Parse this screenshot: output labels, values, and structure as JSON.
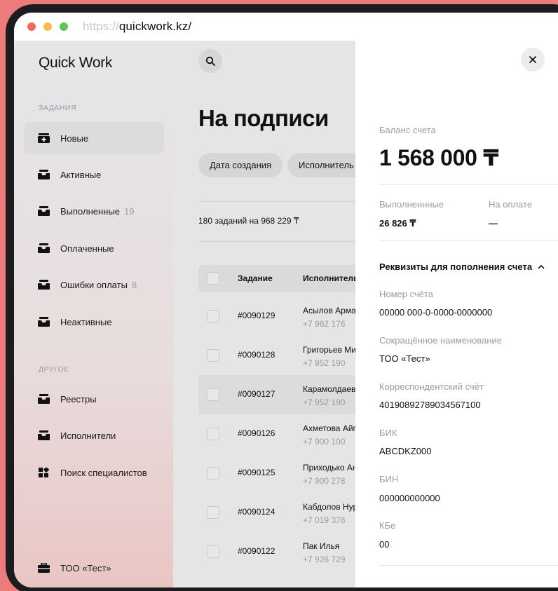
{
  "browser": {
    "url_protocol": "https://",
    "url_host": "quickwork.kz/"
  },
  "sidebar": {
    "logo": "Quick Work",
    "section_tasks": "ЗАДАНИЯ",
    "section_other": "ДРУГОЕ",
    "items": [
      {
        "label": "Новые",
        "count": "",
        "icon": "inbox-plus-icon"
      },
      {
        "label": "Активные",
        "count": "",
        "icon": "inbox-icon"
      },
      {
        "label": "Выполненные",
        "count": "19",
        "icon": "inbox-icon"
      },
      {
        "label": "Оплаченные",
        "count": "",
        "icon": "inbox-icon"
      },
      {
        "label": "Ошибки оплаты",
        "count": "8",
        "icon": "inbox-icon"
      },
      {
        "label": "Неактивные",
        "count": "",
        "icon": "inbox-icon"
      }
    ],
    "other_items": [
      {
        "label": "Реестры",
        "icon": "inbox-icon"
      },
      {
        "label": "Исполнители",
        "icon": "inbox-icon"
      },
      {
        "label": "Поиск специалистов",
        "icon": "grid-icon"
      }
    ],
    "company": "ТОО «Тест»"
  },
  "main": {
    "title": "На подписи",
    "filters": [
      "Дата создания",
      "Исполнитель"
    ],
    "summary": "180 заданий на 968 229 ₸",
    "columns": [
      "Задание",
      "Исполнитель"
    ],
    "rows": [
      {
        "task": "#0090129",
        "name": "Асылов Арман",
        "phone": "+7 962 176"
      },
      {
        "task": "#0090128",
        "name": "Григорьев Михаил",
        "phone": "+7 952 190"
      },
      {
        "task": "#0090127",
        "name": "Карамолдаев",
        "phone": "+7 952 190"
      },
      {
        "task": "#0090126",
        "name": "Ахметова Айгуль",
        "phone": "+7 900 100"
      },
      {
        "task": "#0090125",
        "name": "Приходько Анна",
        "phone": "+7 900 278"
      },
      {
        "task": "#0090124",
        "name": "Кабдолов Нурлан",
        "phone": "+7 019 378"
      },
      {
        "task": "#0090122",
        "name": "Пак Илья",
        "phone": "+7 926 729"
      }
    ]
  },
  "panel": {
    "balance_label": "Баланс счета",
    "balance_value": "1 568 000 ₸",
    "done_label": "Выполненнные",
    "done_value": "26 826 ₸",
    "payment_label": "На оплате",
    "payment_value": "—",
    "requisites_title": "Реквизиты для пополнения счета",
    "fields": [
      {
        "label": "Номер счёта",
        "value": "00000 000-0-0000-0000000"
      },
      {
        "label": "Сокращённое наименование",
        "value": "ТОО «Тест»"
      },
      {
        "label": "Корреспондентский счёт",
        "value": "40190892789034567100"
      },
      {
        "label": "БИК",
        "value": "ABCDKZ000"
      },
      {
        "label": "БИН",
        "value": "000000000000"
      },
      {
        "label": "КБе",
        "value": "00"
      }
    ]
  }
}
